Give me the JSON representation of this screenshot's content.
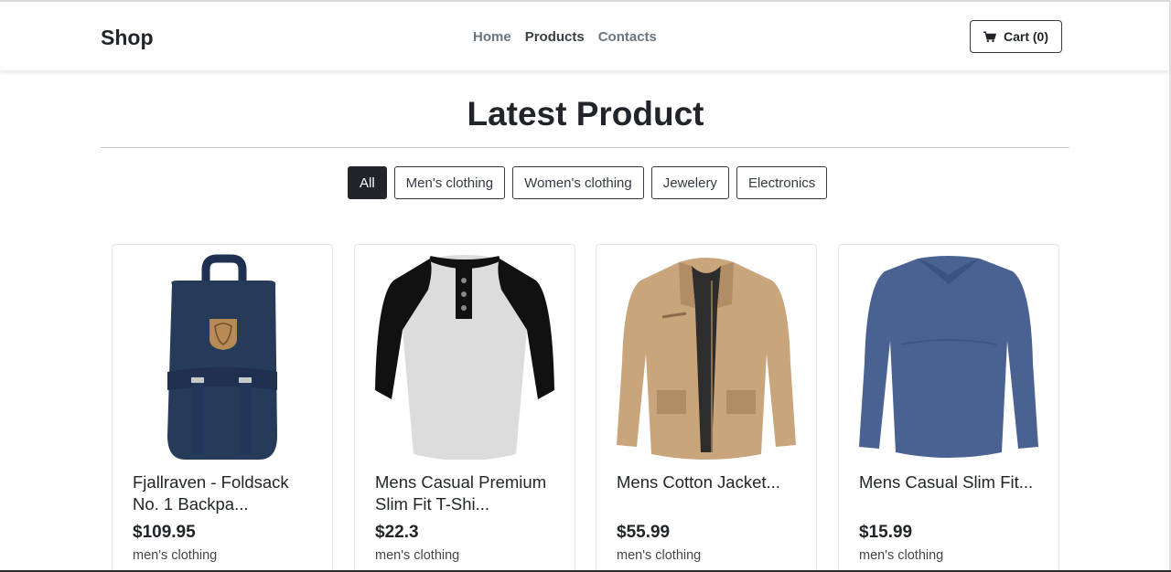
{
  "navbar": {
    "brand": "Shop",
    "links": [
      {
        "label": "Home",
        "active": false
      },
      {
        "label": "Products",
        "active": true
      },
      {
        "label": "Contacts",
        "active": false
      }
    ],
    "cart_label": "Cart (0)",
    "cart_icon": "shopping-cart-icon"
  },
  "page": {
    "heading": "Latest Product"
  },
  "filters": [
    {
      "label": "All",
      "active": true
    },
    {
      "label": "Men's clothing",
      "active": false
    },
    {
      "label": "Women's clothing",
      "active": false
    },
    {
      "label": "Jewelery",
      "active": false
    },
    {
      "label": "Electronics",
      "active": false
    }
  ],
  "products": [
    {
      "title": "Fjallraven - Foldsack No. 1 Backpa...",
      "price": "$109.95",
      "category": "men's clothing",
      "image": "navy-backpack"
    },
    {
      "title": "Mens Casual Premium Slim Fit T-Shi...",
      "price": "$22.3",
      "category": "men's clothing",
      "image": "raglan-t-shirt"
    },
    {
      "title": "Mens Cotton Jacket...",
      "price": "$55.99",
      "category": "men's clothing",
      "image": "khaki-jacket"
    },
    {
      "title": "Mens Casual Slim Fit...",
      "price": "$15.99",
      "category": "men's clothing",
      "image": "blue-long-sleeve-shirt"
    }
  ],
  "colors": {
    "primary_dark": "#212529",
    "nav_muted": "#6c757d",
    "backpack": "#263a5a",
    "jacket": "#c9a57c",
    "shirt_blue": "#4a6291"
  }
}
